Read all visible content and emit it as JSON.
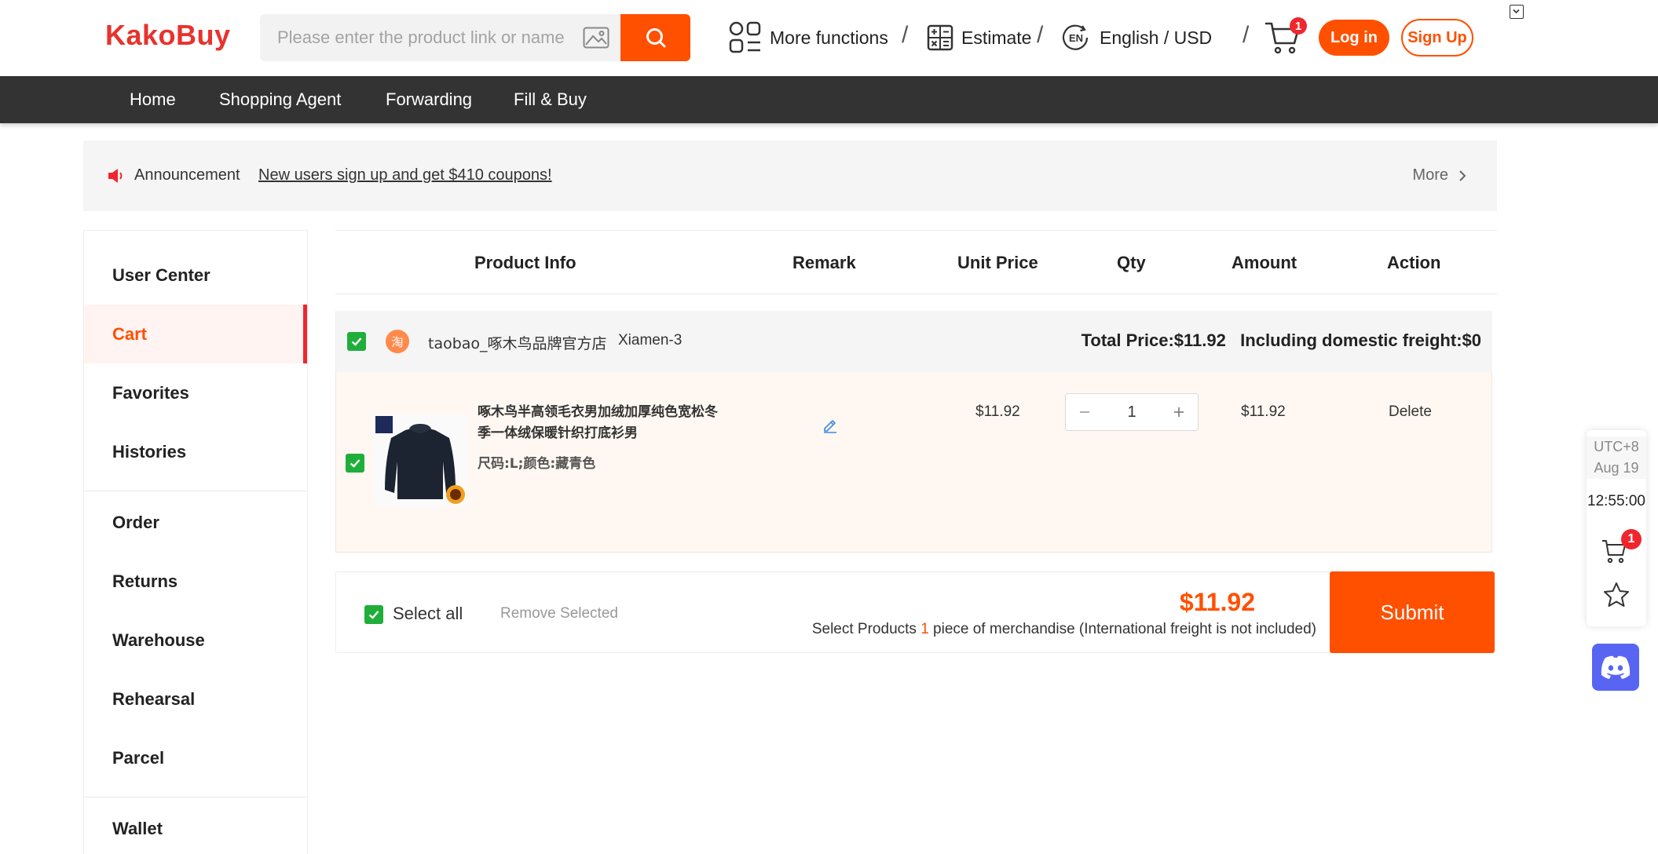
{
  "header": {
    "logo": "KakoBuy",
    "search_placeholder": "Please enter the product link or name",
    "more_functions": "More functions",
    "estimate": "Estimate",
    "language_badge": "EN",
    "language": "English / USD",
    "cart_count": "1",
    "login": "Log in",
    "signup": "Sign Up",
    "accent_color": "#ff5000"
  },
  "nav": {
    "items": [
      "Home",
      "Shopping Agent",
      "Forwarding",
      "Fill & Buy"
    ]
  },
  "announcement": {
    "label": "Announcement",
    "message": "New users sign up and get $410 coupons!",
    "more": "More"
  },
  "sidebar": {
    "items": [
      "User Center",
      "Cart",
      "Favorites",
      "Histories",
      "Order",
      "Returns",
      "Warehouse",
      "Rehearsal",
      "Parcel",
      "Wallet"
    ],
    "active": "Cart"
  },
  "table": {
    "headers": [
      "Product Info",
      "Remark",
      "Unit Price",
      "Qty",
      "Amount",
      "Action"
    ]
  },
  "shop": {
    "icon_glyph": "淘",
    "name": "taobao_啄木鸟品牌官方店",
    "warehouse": "Xiamen-3",
    "total": "Total Price:$11.92   Including domestic freight:$0"
  },
  "item": {
    "title": "啄木鸟半高领毛衣男加绒加厚纯色宽松冬季一体绒保暖针织打底衫男",
    "attrs": "尺码:L;颜色:藏青色",
    "unit_price": "$11.92",
    "qty": "1",
    "amount": "$11.92",
    "action": "Delete"
  },
  "footer": {
    "select_all": "Select all",
    "remove_selected": "Remove Selected",
    "total": "$11.92",
    "note_prefix": "Select Products ",
    "note_count": "1",
    "note_suffix": " piece of merchandise (International freight is not included)",
    "submit": "Submit"
  },
  "float_panel": {
    "timezone": "UTC+8",
    "date": "Aug 19",
    "time": "12:55:00",
    "cart_count": "1"
  }
}
